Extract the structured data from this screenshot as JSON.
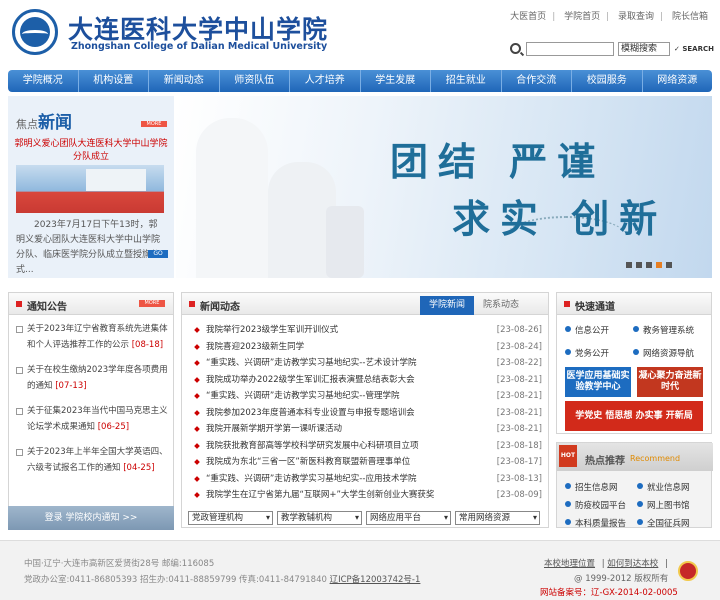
{
  "header": {
    "logo_cn": "大连医科大学中山学院",
    "logo_en": "Zhongshan College of Dalian Medical University",
    "top_links": [
      "大医首页",
      "学院首页",
      "录取查询",
      "院长信箱"
    ],
    "search": {
      "placeholder": "",
      "select_value": "模糊搜索",
      "button_label": "SEARCH"
    }
  },
  "nav": [
    "学院概况",
    "机构设置",
    "新闻动态",
    "师资队伍",
    "人才培养",
    "学生发展",
    "招生就业",
    "合作交流",
    "校园服务",
    "网络资源"
  ],
  "focus_news": {
    "label_small": "焦点",
    "label_big": "新闻",
    "more": "MORE",
    "headline": "郭明义爱心团队大连医科大学中山学院分队成立",
    "summary": "2023年7月17日下午13时，郭明义爱心团队大连医科大学中山学院分队、临床医学院分队成立暨授旗仪式...",
    "go": "GO"
  },
  "banner": {
    "slogan_line1": "团结 严谨",
    "slogan_line2": "求实 创新",
    "slides": 5,
    "active_slide": 4
  },
  "notice": {
    "title": "通知公告",
    "more": "MORE",
    "items": [
      {
        "text": "关于2023年辽宁省教育系统先进集体和个人评选推荐工作的公示",
        "date": "[08-18]"
      },
      {
        "text": "关于在校生缴纳2023学年度各项费用的通知",
        "date": "[07-13]"
      },
      {
        "text": "关于征集2023年当代中国马克思主义论坛学术成果通知",
        "date": "[06-25]"
      },
      {
        "text": "关于2023年上半年全国大学英语四、六级考试报名工作的通知",
        "date": "[04-25]"
      }
    ]
  },
  "login": {
    "label": "登录  学院校内通知 >>"
  },
  "news_panel": {
    "title": "新闻动态",
    "tabs": [
      "学院新闻",
      "院系动态"
    ],
    "active_tab": 0,
    "items": [
      {
        "text": "我院举行2023级学生军训开训仪式",
        "date": "[23-08-26]"
      },
      {
        "text": "我院喜迎2023级新生同学",
        "date": "[23-08-24]"
      },
      {
        "text": "“重实践、兴调研”走访教学实习基地纪实--艺术设计学院",
        "date": "[23-08-22]"
      },
      {
        "text": "我院成功举办2022级学生军训汇报表演暨总结表彰大会",
        "date": "[23-08-21]"
      },
      {
        "text": "“重实践、兴调研”走访教学实习基地纪实--管理学院",
        "date": "[23-08-21]"
      },
      {
        "text": "我院参加2023年度普通本科专业设置与申报专题培训会",
        "date": "[23-08-21]"
      },
      {
        "text": "我院开展新学期开学第一课听课活动",
        "date": "[23-08-21]"
      },
      {
        "text": "我院获批教育部高等学校科学研究发展中心科研项目立项",
        "date": "[23-08-18]"
      },
      {
        "text": "我院成为东北“三省一区”新医科教育联盟新晋理事单位",
        "date": "[23-08-17]"
      },
      {
        "text": "“重实践、兴调研”走访教学实习基地纪实--应用技术学院",
        "date": "[23-08-13]"
      },
      {
        "text": "我院学生在辽宁省第九届“互联网+”大学生创新创业大赛获奖",
        "date": "[23-08-09]"
      }
    ],
    "selects": [
      "党政管理机构",
      "教学教辅机构",
      "网络应用平台",
      "常用网络资源"
    ]
  },
  "quick": {
    "title": "快速通道",
    "links": [
      "信息公开",
      "教务管理系统",
      "党务公开",
      "网络资源导航"
    ],
    "img_buttons": [
      {
        "text": "医学应用基础实验教学中心",
        "color": "#1d6cc0"
      },
      {
        "text": "凝心聚力奋进新时代",
        "color": "#c2371f"
      },
      {
        "text": "学党史 悟思想 办实事 开新局",
        "color": "#d22a1a"
      }
    ]
  },
  "recommend": {
    "hot": "HOT",
    "title": "热点推荐",
    "title_en": "Recommend",
    "links": [
      "招生信息网",
      "就业信息网",
      "防疫校园平台",
      "网上图书馆",
      "本科质量报告",
      "全国征兵网"
    ]
  },
  "footer": {
    "address": "中国·辽宁·大连市高新区爱贤街28号  邮编:116085",
    "phones": "党政办公室:0411-86805393  招生办:0411-88859799  传真:0411-84791840",
    "icp": "辽ICP备12003742号-1",
    "links": [
      "本校地理位置",
      "如何到达本校"
    ],
    "copyright": "@ 1999-2012 版权所有",
    "filing": "网站备案号：辽-GX-2014-02-0005"
  }
}
